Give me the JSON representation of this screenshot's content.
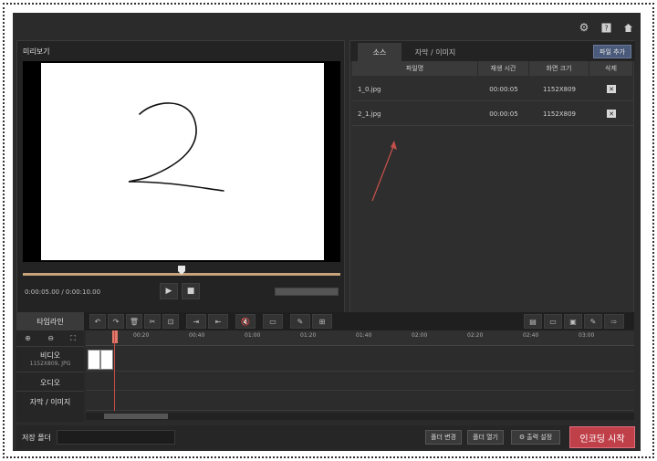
{
  "header": {
    "icons": [
      "gear-icon",
      "help-icon",
      "home-icon"
    ]
  },
  "preview": {
    "title": "미리보기",
    "timecode": "0:00:05.00 / 0:00:10.00",
    "progress": 0.5
  },
  "source": {
    "tabs": [
      "소스",
      "자막 / 이미지"
    ],
    "add_file": "파일 추가",
    "columns": [
      "파일명",
      "재생 시간",
      "화면 크기",
      "삭제"
    ],
    "rows": [
      {
        "name": "1_0.jpg",
        "duration": "00:00:05",
        "size": "1152X809"
      },
      {
        "name": "2_1.jpg",
        "duration": "00:00:05",
        "size": "1152X809"
      }
    ]
  },
  "timeline": {
    "label": "타임라인",
    "ruler": [
      "00:20",
      "00:40",
      "01:00",
      "01:20",
      "01:40",
      "02:00",
      "02:20",
      "02:40",
      "03:00"
    ],
    "tracks": {
      "video": "비디오",
      "video_sub": "1152X809, JPG",
      "audio": "오디오",
      "subtitle": "자막 / 이미지"
    }
  },
  "bottom": {
    "save_folder": "저장 폴더",
    "change_folder": "폴더 변경",
    "open_folder": "폴더 열기",
    "output_settings": "출력 설정",
    "start_encoding": "인코딩 시작"
  },
  "colors": {
    "accent": "#c0404a",
    "seek": "#c8a27a",
    "annotation_arrow": "#c0504a"
  }
}
